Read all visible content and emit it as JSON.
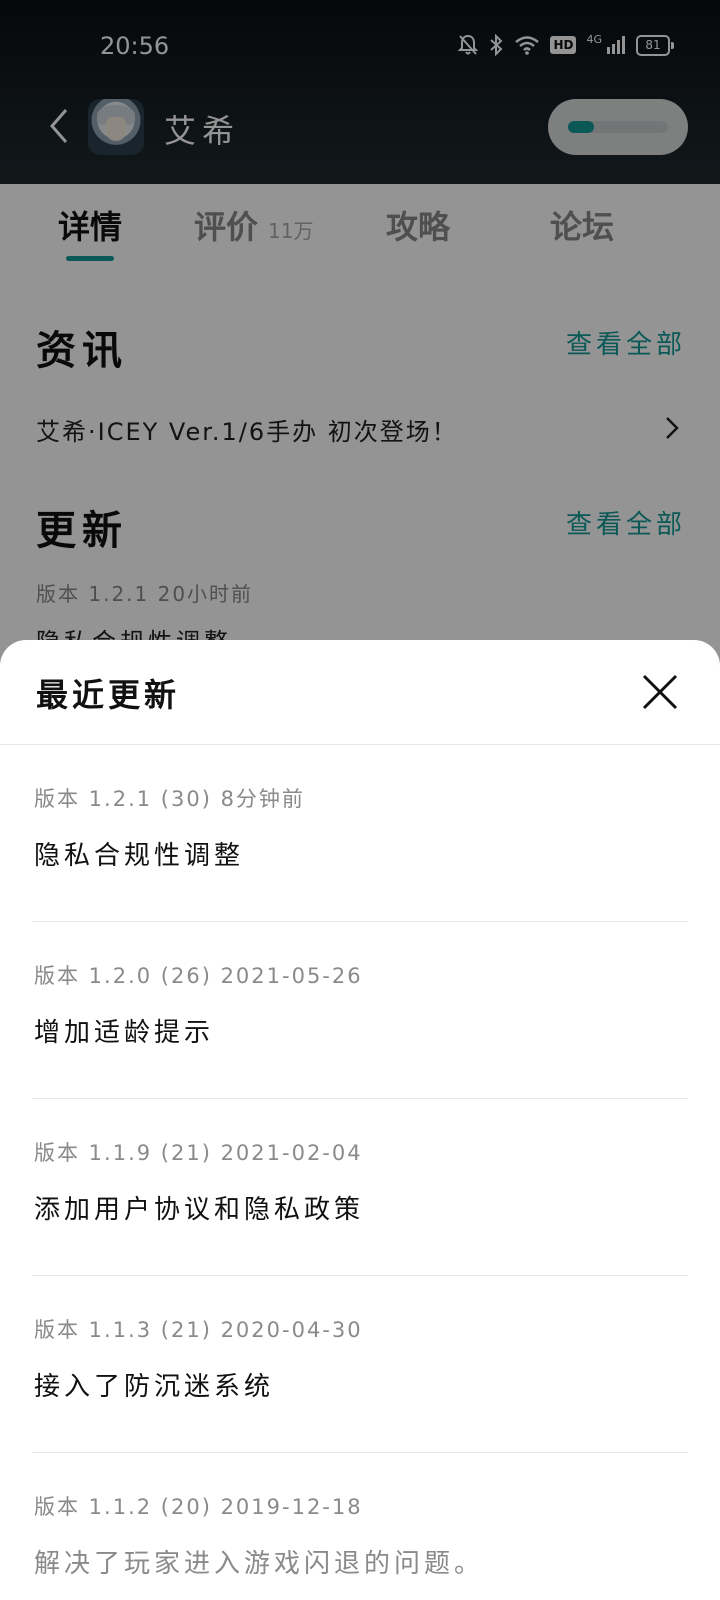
{
  "status_bar": {
    "time": "20:56",
    "hd": "HD",
    "network": "4G",
    "battery": "81"
  },
  "app": {
    "title": "艾希",
    "accent_color": "#139a96"
  },
  "tabs": [
    {
      "label": "详情",
      "count": ""
    },
    {
      "label": "评价",
      "count": "11万"
    },
    {
      "label": "攻略",
      "count": ""
    },
    {
      "label": "论坛",
      "count": ""
    }
  ],
  "news": {
    "title": "资讯",
    "view_all": "查看全部",
    "item": "艾希·ICEY Ver.1/6手办 初次登场！"
  },
  "updates": {
    "title": "更新",
    "view_all": "查看全部",
    "meta": "版本 1.2.1  20小时前",
    "text": "隐私合规性调整"
  },
  "sheet": {
    "title": "最近更新",
    "entries": [
      {
        "meta": "版本 1.2.1 (30)  8分钟前",
        "text": "隐私合规性调整"
      },
      {
        "meta": "版本 1.2.0 (26)  2021-05-26",
        "text": "增加适龄提示"
      },
      {
        "meta": "版本 1.1.9 (21)  2021-02-04",
        "text": "添加用户协议和隐私政策"
      },
      {
        "meta": "版本 1.1.3 (21)  2020-04-30",
        "text": "接入了防沉迷系统"
      },
      {
        "meta": "版本 1.1.2 (20)  2019-12-18",
        "text": "解决了玩家进入游戏闪退的问题。"
      }
    ]
  }
}
